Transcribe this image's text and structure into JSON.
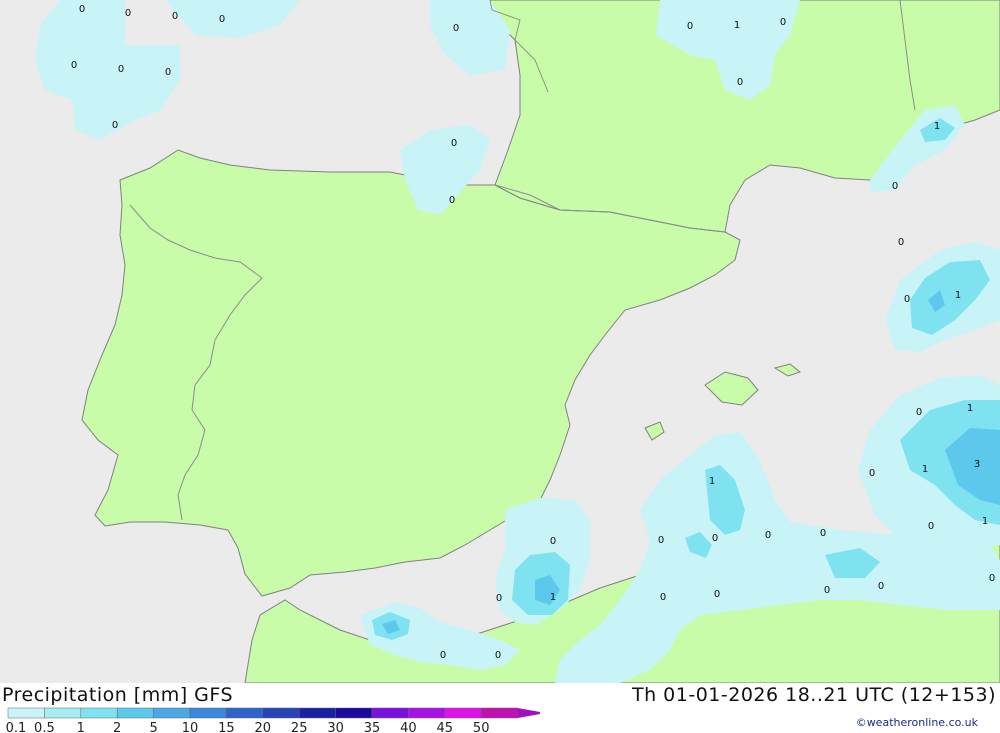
{
  "map": {
    "colors": {
      "sea": "#ebebeb",
      "land": "#c8fca8",
      "border": "#8c8c8c",
      "coast": "#808080"
    },
    "point_labels": [
      "0",
      "0",
      "0",
      "0",
      "0",
      "0",
      "0",
      "0",
      "0",
      "0",
      "0",
      "0",
      "1",
      "0",
      "0",
      "1",
      "0",
      "0",
      "1",
      "0",
      "1",
      "0",
      "1",
      "3",
      "1",
      "0",
      "1",
      "0",
      "0",
      "0",
      "0",
      "0",
      "1",
      "0",
      "0",
      "0",
      "0",
      "0",
      "0",
      "0",
      "0",
      "0"
    ]
  },
  "legend": {
    "title": "Precipitation [mm]  GFS",
    "time": "Th 01-01-2026 18..21 UTC (12+153)",
    "colorbar": [
      {
        "label": "0.1",
        "color": "#c8f4f8"
      },
      {
        "label": "0.5",
        "color": "#a4eef4"
      },
      {
        "label": "1",
        "color": "#7ee2f0"
      },
      {
        "label": "2",
        "color": "#5cc8ec"
      },
      {
        "label": "5",
        "color": "#4aa8e4"
      },
      {
        "label": "10",
        "color": "#3a88dc"
      },
      {
        "label": "15",
        "color": "#2f63cc"
      },
      {
        "label": "20",
        "color": "#2444b8"
      },
      {
        "label": "25",
        "color": "#1a22a4"
      },
      {
        "label": "30",
        "color": "#1c0aa0"
      },
      {
        "label": "35",
        "color": "#7a10e0"
      },
      {
        "label": "40",
        "color": "#a810e8"
      },
      {
        "label": "45",
        "color": "#e010e8"
      },
      {
        "label": "50",
        "color": "#c010b0"
      }
    ],
    "credit": "©weatheronline.co.uk"
  }
}
